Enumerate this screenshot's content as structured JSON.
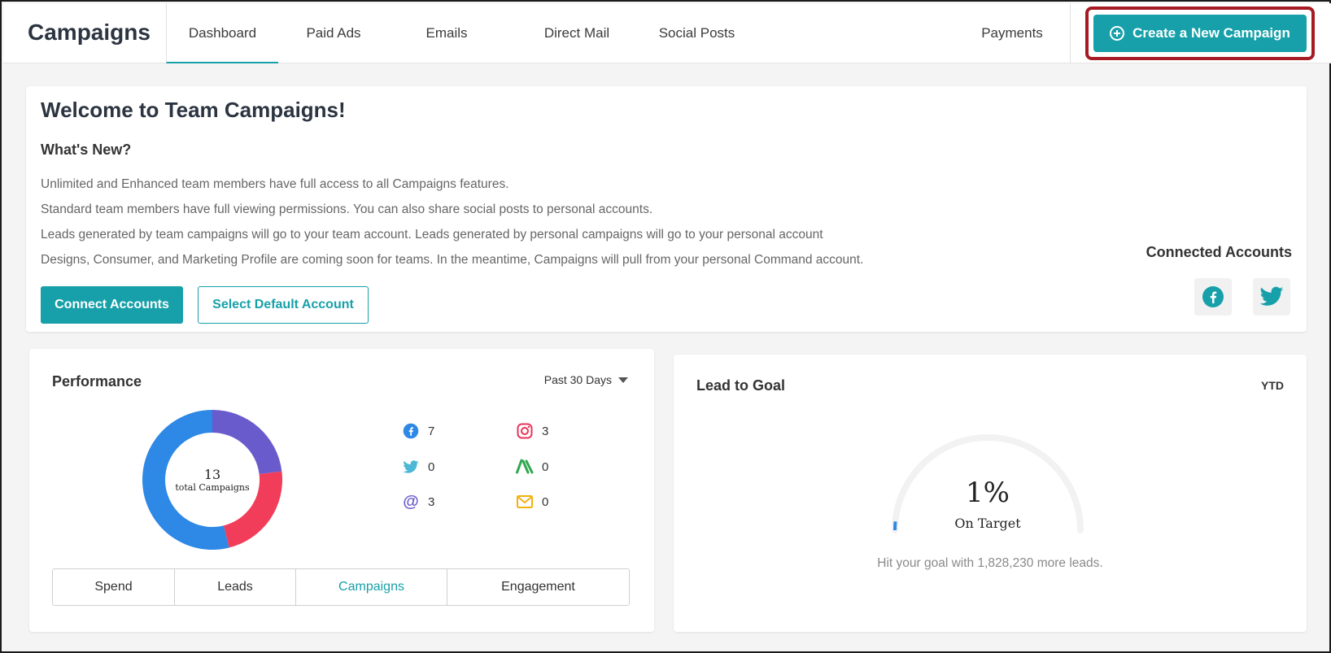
{
  "header": {
    "title": "Campaigns",
    "tabs": [
      {
        "label": "Dashboard",
        "active": true
      },
      {
        "label": "Paid Ads",
        "active": false
      },
      {
        "label": "Emails",
        "active": false
      },
      {
        "label": "Direct Mail",
        "active": false
      },
      {
        "label": "Social Posts",
        "active": false
      }
    ],
    "payments_label": "Payments",
    "create_label": "Create a New Campaign"
  },
  "welcome": {
    "title": "Welcome to Team Campaigns!",
    "subtitle": "What's New?",
    "notes": [
      "Unlimited and Enhanced team members have full access to all Campaigns features.",
      "Standard team members have full viewing permissions. You can also share social posts to personal accounts.",
      "Leads generated by team campaigns will go to your team account. Leads generated by personal campaigns will go to your personal account",
      "Designs, Consumer, and Marketing Profile are coming soon for teams. In the meantime, Campaigns will pull from your personal Command account."
    ],
    "connect_label": "Connect Accounts",
    "default_label": "Select Default Account",
    "connected_title": "Connected Accounts",
    "connected_icons": [
      "facebook-icon",
      "twitter-icon"
    ]
  },
  "performance": {
    "title": "Performance",
    "range": "Past 30 Days",
    "total": "13",
    "total_label": "total Campaigns",
    "stats": [
      {
        "icon": "facebook-icon",
        "value": "7"
      },
      {
        "icon": "instagram-icon",
        "value": "3"
      },
      {
        "icon": "twitter-icon",
        "value": "0"
      },
      {
        "icon": "adwords-icon",
        "value": "0"
      },
      {
        "icon": "at-icon",
        "value": "3"
      },
      {
        "icon": "mail-icon",
        "value": "0"
      }
    ],
    "segments": [
      "Spend",
      "Leads",
      "Campaigns",
      "Engagement"
    ],
    "active_segment": "Campaigns",
    "chart_data": {
      "type": "pie",
      "categories": [
        "Facebook",
        "Instagram",
        "Email"
      ],
      "values": [
        7,
        3,
        3
      ],
      "colors": [
        "#2d88e6",
        "#f23d5a",
        "#6a5bcc"
      ]
    }
  },
  "goal": {
    "title": "Lead to Goal",
    "period": "YTD",
    "percent": "1%",
    "percent_value": 0.01,
    "status": "On Target",
    "message": "Hit your goal with 1,828,230 more leads."
  },
  "colors": {
    "accent": "#17a0a9",
    "highlight": "#a61b23",
    "facebook": "#2d88e6",
    "instagram": "#e8335a",
    "twitter": "#4bb8d6",
    "adwords": "#2fa84f",
    "at": "#6a5bcc",
    "mail": "#f2b10c"
  }
}
